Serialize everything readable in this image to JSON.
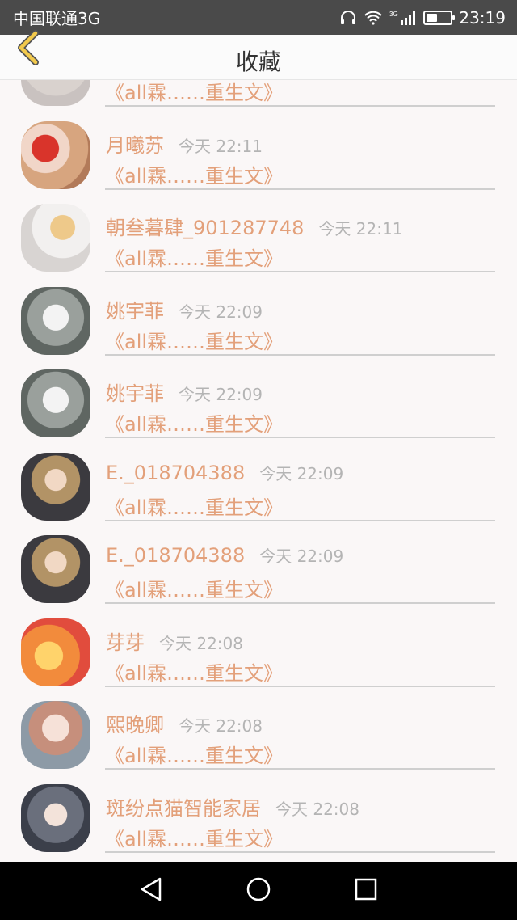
{
  "status_bar": {
    "carrier": "中国联通3G",
    "network_badge": "3G",
    "time": "23:19",
    "icons": [
      "headset-icon",
      "wifi-icon",
      "signal-icon",
      "battery-icon"
    ],
    "battery_level": 0.45
  },
  "header": {
    "title": "收藏",
    "back_icon": "chevron-left-icon",
    "accent_color": "#f2c94c"
  },
  "colors": {
    "name": "#e3a07a",
    "time": "#b4b4b4",
    "divider": "#cfcfcf",
    "background": "#faf7f7"
  },
  "rows": [
    {
      "name": "",
      "time": "",
      "title": "《all霖……重生文》"
    },
    {
      "name": "月曦苏",
      "time": "今天 22:11",
      "title": "《all霖……重生文》"
    },
    {
      "name": "朝叁暮肆_901287748",
      "time": "今天 22:11",
      "title": "《all霖……重生文》"
    },
    {
      "name": "姚宇菲",
      "time": "今天 22:09",
      "title": "《all霖……重生文》"
    },
    {
      "name": "姚宇菲",
      "time": "今天 22:09",
      "title": "《all霖……重生文》"
    },
    {
      "name": "E._018704388",
      "time": "今天 22:09",
      "title": "《all霖……重生文》"
    },
    {
      "name": "E._018704388",
      "time": "今天 22:09",
      "title": "《all霖……重生文》"
    },
    {
      "name": "芽芽",
      "time": "今天 22:08",
      "title": "《all霖……重生文》"
    },
    {
      "name": "熙晚卿",
      "time": "今天 22:08",
      "title": "《all霖……重生文》"
    },
    {
      "name": "斑纷点猫智能家居",
      "time": "今天 22:08",
      "title": "《all霖……重生文》"
    }
  ],
  "nav_bar": {
    "back_icon": "triangle-back-icon",
    "home_icon": "circle-home-icon",
    "recents_icon": "square-recents-icon"
  }
}
